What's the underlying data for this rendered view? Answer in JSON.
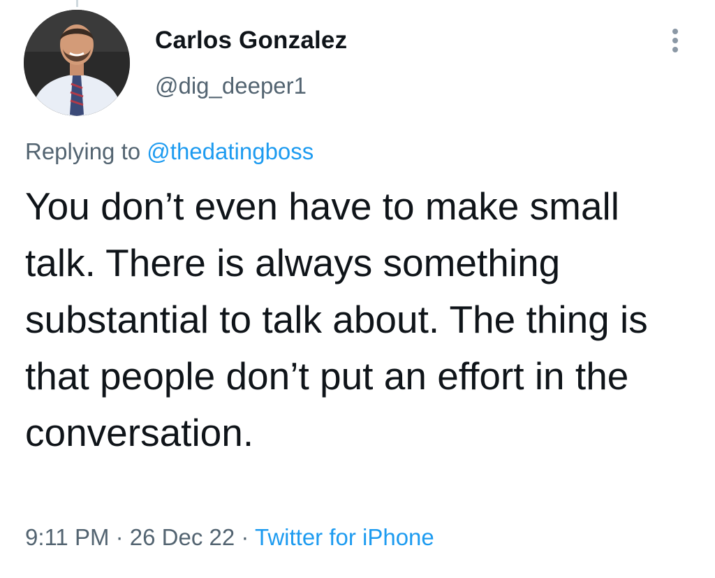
{
  "author": {
    "display_name": "Carlos Gonzalez",
    "handle": "@dig_deeper1",
    "avatar_icon": "profile-photo-icon"
  },
  "reply": {
    "prefix": "Replying to",
    "mention": "@thedatingboss"
  },
  "body": {
    "text": "You don’t even have to make small talk. There is always something substantial to talk about. The thing is that people don’t put an effort in the conversation."
  },
  "meta": {
    "time": "9:11 PM",
    "separator": "·",
    "date": "26 Dec 22",
    "source": "Twitter for iPhone"
  },
  "colors": {
    "text_primary": "#0f1419",
    "text_secondary": "#536471",
    "accent": "#1d9bf0",
    "background": "#ffffff"
  },
  "icons": {
    "more": "more-vertical-icon"
  }
}
